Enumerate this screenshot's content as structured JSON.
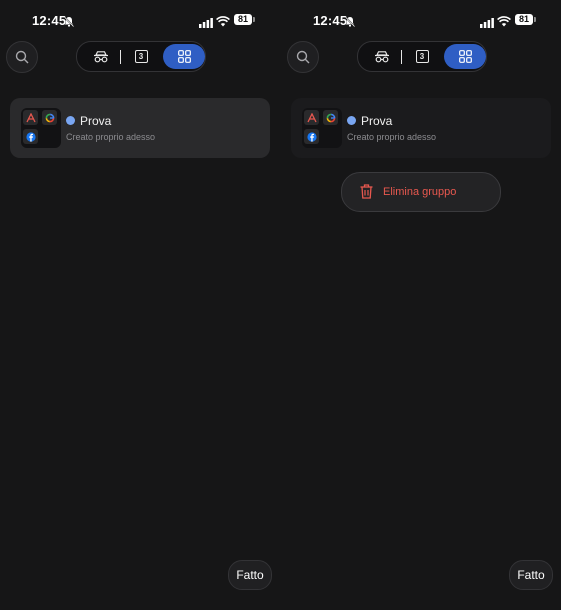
{
  "status_bar": {
    "time": "12:45",
    "battery": "81"
  },
  "toolbar": {
    "search_icon": "search-icon",
    "tabs": {
      "incognito_icon": "incognito-icon",
      "tab_count": "3",
      "groups_icon": "tab-groups-icon"
    }
  },
  "group": {
    "name": "Prova",
    "subtitle": "Creato proprio adesso",
    "dot_color": "#79a6f2",
    "apps": [
      "acrobat-icon",
      "google-icon",
      "facebook-icon"
    ]
  },
  "menu": {
    "delete_label": "Elimina gruppo",
    "delete_color": "#e8584f"
  },
  "footer": {
    "done_label": "Fatto"
  },
  "colors": {
    "background": "#161617",
    "accent": "#2f5ec4"
  }
}
